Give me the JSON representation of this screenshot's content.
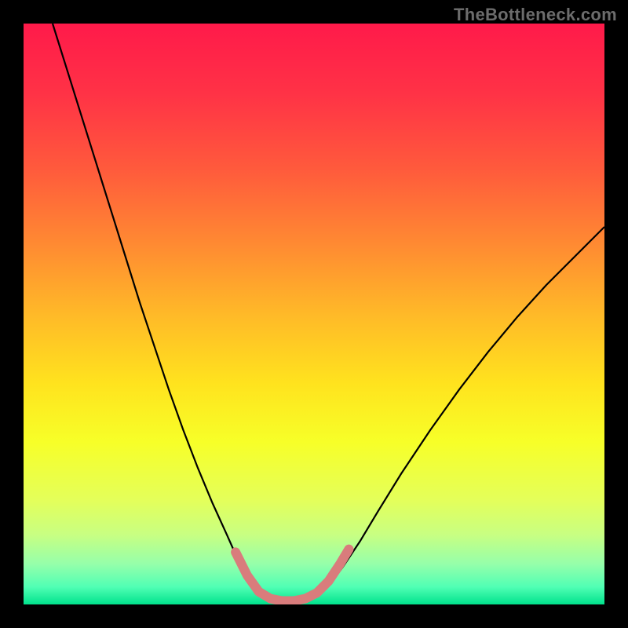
{
  "watermark": "TheBottleneck.com",
  "chart_data": {
    "type": "line",
    "title": "",
    "xlabel": "",
    "ylabel": "",
    "xlim": [
      0,
      100
    ],
    "ylim": [
      0,
      100
    ],
    "background_gradient": {
      "stops": [
        {
          "offset": 0.0,
          "color": "#ff1a4a"
        },
        {
          "offset": 0.12,
          "color": "#ff3246"
        },
        {
          "offset": 0.25,
          "color": "#ff5a3c"
        },
        {
          "offset": 0.38,
          "color": "#ff8a32"
        },
        {
          "offset": 0.5,
          "color": "#ffb928"
        },
        {
          "offset": 0.62,
          "color": "#ffe31e"
        },
        {
          "offset": 0.72,
          "color": "#f7ff28"
        },
        {
          "offset": 0.82,
          "color": "#e4ff5a"
        },
        {
          "offset": 0.88,
          "color": "#c8ff82"
        },
        {
          "offset": 0.93,
          "color": "#96ffaa"
        },
        {
          "offset": 0.97,
          "color": "#50ffb4"
        },
        {
          "offset": 1.0,
          "color": "#00e28c"
        }
      ]
    },
    "series": [
      {
        "name": "bottleneck-curve",
        "color": "#000000",
        "width": 2.2,
        "points": [
          {
            "x": 5.0,
            "y": 100.0
          },
          {
            "x": 7.5,
            "y": 92.0
          },
          {
            "x": 10.0,
            "y": 84.0
          },
          {
            "x": 12.5,
            "y": 76.0
          },
          {
            "x": 15.0,
            "y": 68.0
          },
          {
            "x": 17.5,
            "y": 60.0
          },
          {
            "x": 20.0,
            "y": 52.0
          },
          {
            "x": 22.5,
            "y": 44.5
          },
          {
            "x": 25.0,
            "y": 37.0
          },
          {
            "x": 27.5,
            "y": 30.0
          },
          {
            "x": 30.0,
            "y": 23.5
          },
          {
            "x": 32.5,
            "y": 17.5
          },
          {
            "x": 35.0,
            "y": 12.0
          },
          {
            "x": 37.0,
            "y": 7.5
          },
          {
            "x": 39.0,
            "y": 4.0
          },
          {
            "x": 41.0,
            "y": 1.8
          },
          {
            "x": 43.0,
            "y": 0.8
          },
          {
            "x": 45.0,
            "y": 0.5
          },
          {
            "x": 47.0,
            "y": 0.5
          },
          {
            "x": 49.0,
            "y": 0.8
          },
          {
            "x": 51.0,
            "y": 1.8
          },
          {
            "x": 53.0,
            "y": 3.8
          },
          {
            "x": 55.0,
            "y": 6.5
          },
          {
            "x": 58.0,
            "y": 11.0
          },
          {
            "x": 61.0,
            "y": 16.0
          },
          {
            "x": 65.0,
            "y": 22.5
          },
          {
            "x": 70.0,
            "y": 30.0
          },
          {
            "x": 75.0,
            "y": 37.0
          },
          {
            "x": 80.0,
            "y": 43.5
          },
          {
            "x": 85.0,
            "y": 49.5
          },
          {
            "x": 90.0,
            "y": 55.0
          },
          {
            "x": 95.0,
            "y": 60.0
          },
          {
            "x": 100.0,
            "y": 65.0
          }
        ]
      },
      {
        "name": "bottom-highlight",
        "color": "#d97c7c",
        "width": 12,
        "linecap": "round",
        "points": [
          {
            "x": 36.5,
            "y": 9.0
          },
          {
            "x": 38.5,
            "y": 5.0
          },
          {
            "x": 40.5,
            "y": 2.2
          },
          {
            "x": 42.5,
            "y": 1.0
          },
          {
            "x": 44.5,
            "y": 0.6
          },
          {
            "x": 46.5,
            "y": 0.6
          },
          {
            "x": 48.5,
            "y": 1.0
          },
          {
            "x": 50.5,
            "y": 2.0
          },
          {
            "x": 52.5,
            "y": 4.0
          },
          {
            "x": 54.5,
            "y": 7.0
          },
          {
            "x": 56.0,
            "y": 9.5
          }
        ]
      }
    ]
  }
}
